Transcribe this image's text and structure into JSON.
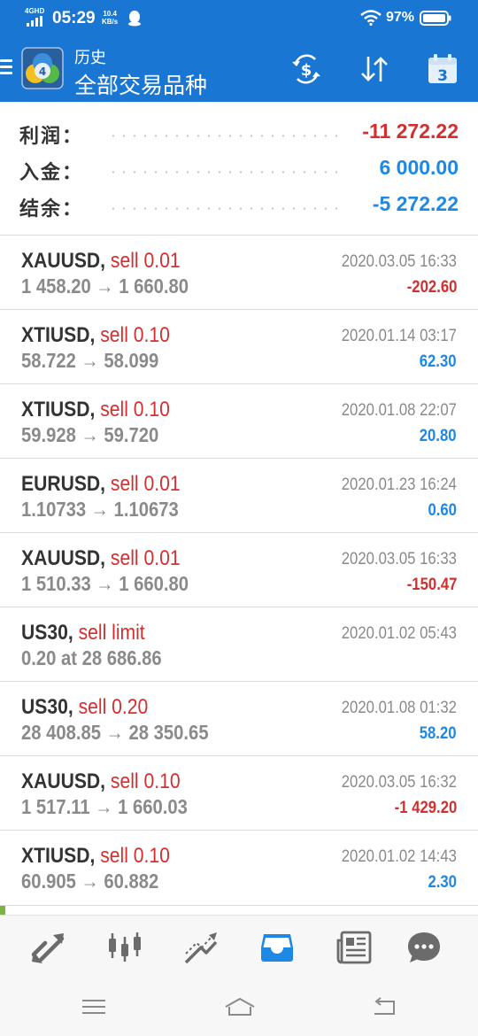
{
  "status_bar": {
    "network": "4GHD",
    "time": "05:29",
    "speed_value": "10.4",
    "speed_unit": "KB/s",
    "battery": "97%",
    "icons": [
      "signal-icon",
      "qq-icon",
      "wifi-icon",
      "battery-icon"
    ]
  },
  "app_bar": {
    "subtitle": "历史",
    "title": "全部交易品种",
    "calendar_day": "3",
    "icons": [
      "menu-icon",
      "metatrader-logo",
      "currency-exchange-icon",
      "sort-icon",
      "calendar-icon"
    ]
  },
  "summary": {
    "rows": [
      {
        "label": "利润：",
        "value": "-11 272.22",
        "color": "#d32f2f"
      },
      {
        "label": "入金：",
        "value": "6 000.00",
        "color": "#1e88e5"
      },
      {
        "label": "结余：",
        "value": "-5 272.22",
        "color": "#1e88e5"
      }
    ]
  },
  "trades": [
    {
      "symbol": "XAUUSD,",
      "side": "sell 0.01",
      "prices": "1 458.20 → 1 660.80",
      "time": "2020.03.05 16:33",
      "profit": "-202.60",
      "profit_color": "#d32f2f"
    },
    {
      "symbol": "XTIUSD,",
      "side": "sell 0.10",
      "prices": "58.722 → 58.099",
      "time": "2020.01.14 03:17",
      "profit": "62.30",
      "profit_color": "#1e88e5"
    },
    {
      "symbol": "XTIUSD,",
      "side": "sell 0.10",
      "prices": "59.928 → 59.720",
      "time": "2020.01.08 22:07",
      "profit": "20.80",
      "profit_color": "#1e88e5"
    },
    {
      "symbol": "EURUSD,",
      "side": "sell 0.01",
      "prices": "1.10733 → 1.10673",
      "time": "2020.01.23 16:24",
      "profit": "0.60",
      "profit_color": "#1e88e5"
    },
    {
      "symbol": "XAUUSD,",
      "side": "sell 0.01",
      "prices": "1 510.33 → 1 660.80",
      "time": "2020.03.05 16:33",
      "profit": "-150.47",
      "profit_color": "#d32f2f"
    },
    {
      "symbol": "US30,",
      "side": "sell limit",
      "prices": "0.20 at 28 686.86",
      "time": "2020.01.02 05:43",
      "profit": "",
      "profit_color": "#1e88e5"
    },
    {
      "symbol": "US30,",
      "side": "sell 0.20",
      "prices": "28 408.85 → 28 350.65",
      "time": "2020.01.08 01:32",
      "profit": "58.20",
      "profit_color": "#1e88e5"
    },
    {
      "symbol": "XAUUSD,",
      "side": "sell 0.10",
      "prices": "1 517.11 → 1 660.03",
      "time": "2020.03.05 16:32",
      "profit": "-1 429.20",
      "profit_color": "#d32f2f"
    },
    {
      "symbol": "XTIUSD,",
      "side": "sell 0.10",
      "prices": "60.905 → 60.882",
      "time": "2020.01.02 14:43",
      "profit": "2.30",
      "profit_color": "#1e88e5"
    }
  ],
  "bottom_nav": {
    "items": [
      {
        "icon": "quotes-icon",
        "active": false
      },
      {
        "icon": "chart-candles-icon",
        "active": false
      },
      {
        "icon": "trade-icon",
        "active": false
      },
      {
        "icon": "history-inbox-icon",
        "active": true
      },
      {
        "icon": "news-icon",
        "active": false
      },
      {
        "icon": "chat-icon",
        "active": false
      }
    ],
    "active_color": "#1e88e5",
    "inactive_color": "#6b6b6b"
  },
  "system_nav": {
    "icons": [
      "recent-apps-icon",
      "home-icon",
      "back-icon"
    ]
  }
}
